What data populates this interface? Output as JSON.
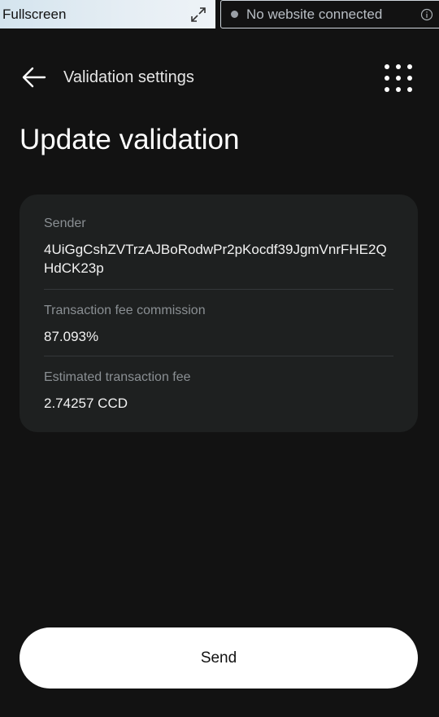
{
  "topbar": {
    "fullscreen_label": "Fullscreen",
    "expand_icon": "expand-icon",
    "connection_status": "No website connected",
    "info_icon": "info-icon"
  },
  "header": {
    "back_icon": "arrow-left-icon",
    "title": "Validation settings",
    "menu_icon": "grid-menu-icon"
  },
  "page": {
    "title": "Update validation"
  },
  "details": {
    "sender_label": "Sender",
    "sender_value": "4UiGgCshZVTrzAJBoRodwPr2pKocdf39JgmVnrFHE2QHdCK23p",
    "commission_label": "Transaction fee commission",
    "commission_value": "87.093%",
    "fee_label": "Estimated transaction fee",
    "fee_value": "2.74257 CCD"
  },
  "actions": {
    "send_label": "Send"
  },
  "colors": {
    "background": "#121212",
    "card": "#1e2020",
    "button": "#ffffff"
  }
}
